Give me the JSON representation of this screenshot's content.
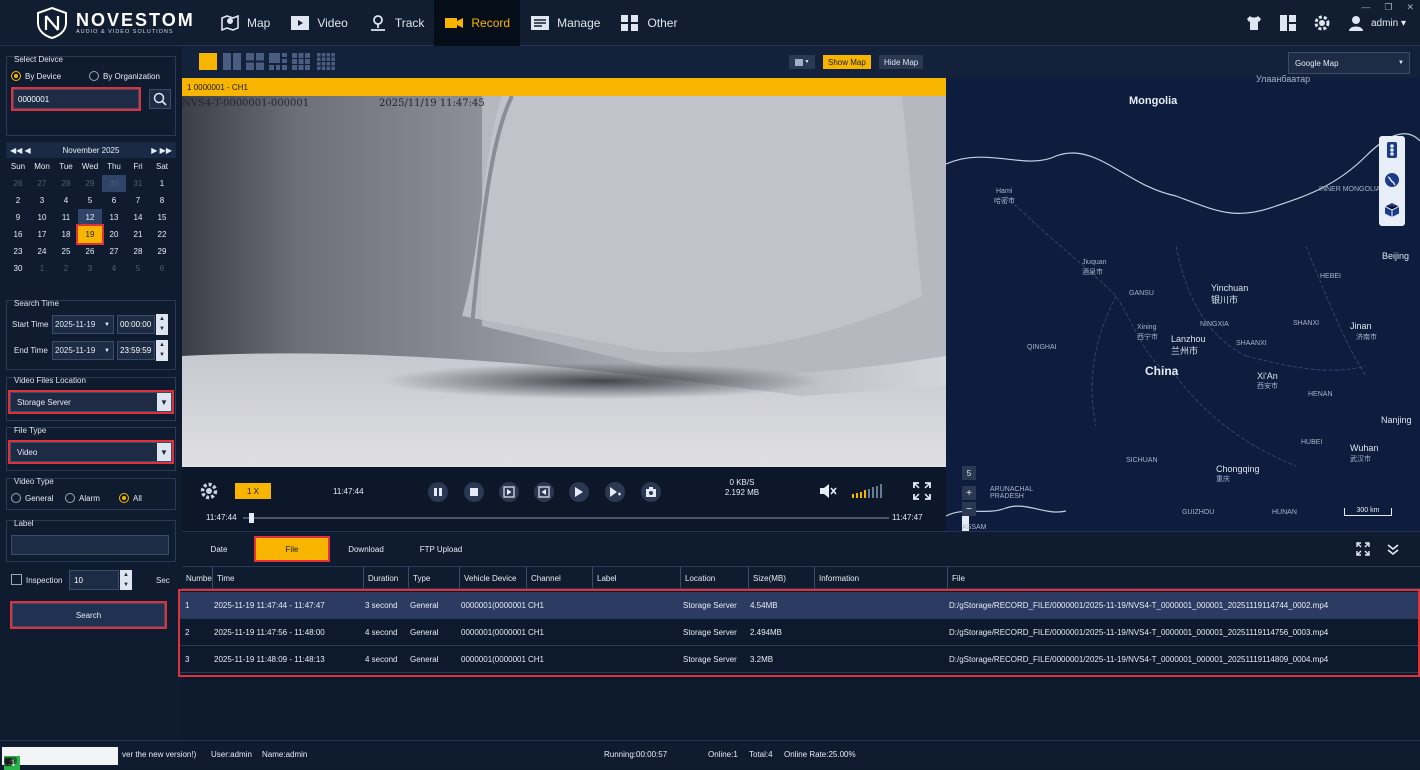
{
  "brand": {
    "name": "NOVESTOM",
    "tagline": "AUDIO & VIDEO SOLUTIONS"
  },
  "nav": [
    {
      "label": "Map",
      "icon": "map-icon"
    },
    {
      "label": "Video",
      "icon": "video-icon"
    },
    {
      "label": "Track",
      "icon": "track-icon"
    },
    {
      "label": "Record",
      "icon": "record-icon",
      "active": true
    },
    {
      "label": "Manage",
      "icon": "manage-icon"
    },
    {
      "label": "Other",
      "icon": "other-icon"
    }
  ],
  "user": {
    "name": "admin ▾"
  },
  "select_device": {
    "title": "Select Deivce",
    "by_device": "By Device",
    "by_org": "By Organization",
    "device_value": "0000001"
  },
  "calendar": {
    "month": "November 2025",
    "weekdays": [
      "Sun",
      "Mon",
      "Tue",
      "Wed",
      "Thu",
      "Fri",
      "Sat"
    ],
    "days": [
      "26",
      "27",
      "28",
      "29",
      "30",
      "31",
      "1",
      "2",
      "3",
      "4",
      "5",
      "6",
      "7",
      "8",
      "9",
      "10",
      "11",
      "12",
      "13",
      "14",
      "15",
      "16",
      "17",
      "18",
      "19",
      "20",
      "21",
      "22",
      "23",
      "24",
      "25",
      "26",
      "27",
      "28",
      "29",
      "30",
      "1",
      "2",
      "3",
      "4",
      "5",
      "6"
    ],
    "dim_indices": [
      0,
      1,
      2,
      3,
      4,
      5,
      36,
      37,
      38,
      39,
      40,
      41
    ],
    "selected_indices": [
      4,
      17
    ],
    "today_index": 24
  },
  "search_time": {
    "title": "Search Time",
    "start_label": "Start Time",
    "start_date": "2025-11-19",
    "start_time": "00:00:00",
    "end_label": "End Time",
    "end_date": "2025-11-19",
    "end_time": "23:59:59"
  },
  "video_location": {
    "title": "Video Files Location",
    "value": "Storage Server"
  },
  "file_type": {
    "title": "File Type",
    "value": "Video"
  },
  "video_type": {
    "title": "Video Type",
    "general": "General",
    "alarm": "Alarm",
    "all": "All"
  },
  "label_section": {
    "title": "Label"
  },
  "inspection": {
    "label": "Inspection",
    "value": "10",
    "unit": "Sec"
  },
  "search_button": "Search",
  "toolbar": {
    "show_map": "Show Map",
    "hide_map": "Hide Map"
  },
  "channel_bar": "1  0000001 - CH1",
  "osd": {
    "device": "NVS4-T-0000001-000001",
    "timestamp": "2025/11/19 11:47:45"
  },
  "player": {
    "speed": "1 X",
    "current_time": "11:47:44",
    "rate": "0 KB/S",
    "size": "2.192 MB",
    "range_start": "11:47:44",
    "range_end": "11:47:47",
    "progress": 0.01
  },
  "map": {
    "provider": "Google Map",
    "labels": {
      "mongolia": "Mongolia",
      "china": "China",
      "yinchuan": "Yinchuan",
      "yinchuan_cn": "银川市",
      "lanzhou": "Lanzhou",
      "lanzhou_cn": "兰州市",
      "xian": "Xi'An",
      "xian_cn": "西安市",
      "chongqing": "Chongqing",
      "chongqing_cn": "重庆",
      "beijing": "Beijing",
      "jinan": "Jinan",
      "jinan_cn": "济南市",
      "wuhan": "Wuhan",
      "wuhan_cn": "武汉市",
      "nanjing": "Nanjing",
      "hami": "Hami",
      "hami_cn": "哈密市",
      "jiuquan": "Jiuquan",
      "jiuquan_cn": "酒泉市",
      "xining": "Xining",
      "xining_cn": "西宁市",
      "gansu": "GANSU",
      "ningxia": "NINGXIA",
      "shaanxi": "SHAANXI",
      "shanxi": "SHANXI",
      "qinghai": "QINGHAI",
      "henan": "HENAN",
      "hebei": "HEBEI",
      "sichuan": "SICHUAN",
      "hubei": "HUBEI",
      "guizhou": "GUIZHOU",
      "hunan": "HUNAN",
      "inner": "INNER\nMONGOLIA",
      "arunachal": "ARUNACHAL\nPRADESH",
      "assam": "ASSAM",
      "ulaanbaatar": "Улаанбаатар",
      "zoom_level": "5",
      "scale": "300 km"
    }
  },
  "tabs": [
    "Date",
    "File",
    "Download",
    "FTP Upload"
  ],
  "table": {
    "columns": [
      "Number",
      "Time",
      "Duration",
      "Type",
      "Vehicle Device",
      "Channel",
      "Label",
      "Location",
      "Size(MB)",
      "Information",
      "File"
    ],
    "rows": [
      {
        "no": "1",
        "time": "2025-11-19 11:47:44 - 11:47:47",
        "duration": "3 second",
        "type": "General",
        "device": "0000001(0000001",
        "channel": "CH1",
        "label": "",
        "location": "Storage Server",
        "size": "4.54MB",
        "info": "",
        "file": "D:/gStorage/RECORD_FILE/0000001/2025-11-19/NVS4-T_0000001_000001_20251119114744_0002.mp4"
      },
      {
        "no": "2",
        "time": "2025-11-19 11:47:56 - 11:48:00",
        "duration": "4 second",
        "type": "General",
        "device": "0000001(0000001",
        "channel": "CH1",
        "label": "",
        "location": "Storage Server",
        "size": "2.494MB",
        "info": "",
        "file": "D:/gStorage/RECORD_FILE/0000001/2025-11-19/NVS4-T_0000001_000001_20251119114756_0003.mp4"
      },
      {
        "no": "3",
        "time": "2025-11-19 11:48:09 - 11:48:13",
        "duration": "4 second",
        "type": "General",
        "device": "0000001(0000001",
        "channel": "CH1",
        "label": "",
        "location": "Storage Server",
        "size": "3.2MB",
        "info": "",
        "file": "D:/gStorage/RECORD_FILE/0000001/2025-11-19/NVS4-T_0000001_000001_20251119114809_0004.mp4"
      }
    ]
  },
  "status": {
    "version": "ver the new version!)",
    "user": "User:admin",
    "name": "Name:admin",
    "running": "Running:00:00:57",
    "online": "Online:1",
    "total": "Total:4",
    "rate": "Online Rate:25.00%"
  },
  "taskbar": {
    "ime": "五"
  }
}
